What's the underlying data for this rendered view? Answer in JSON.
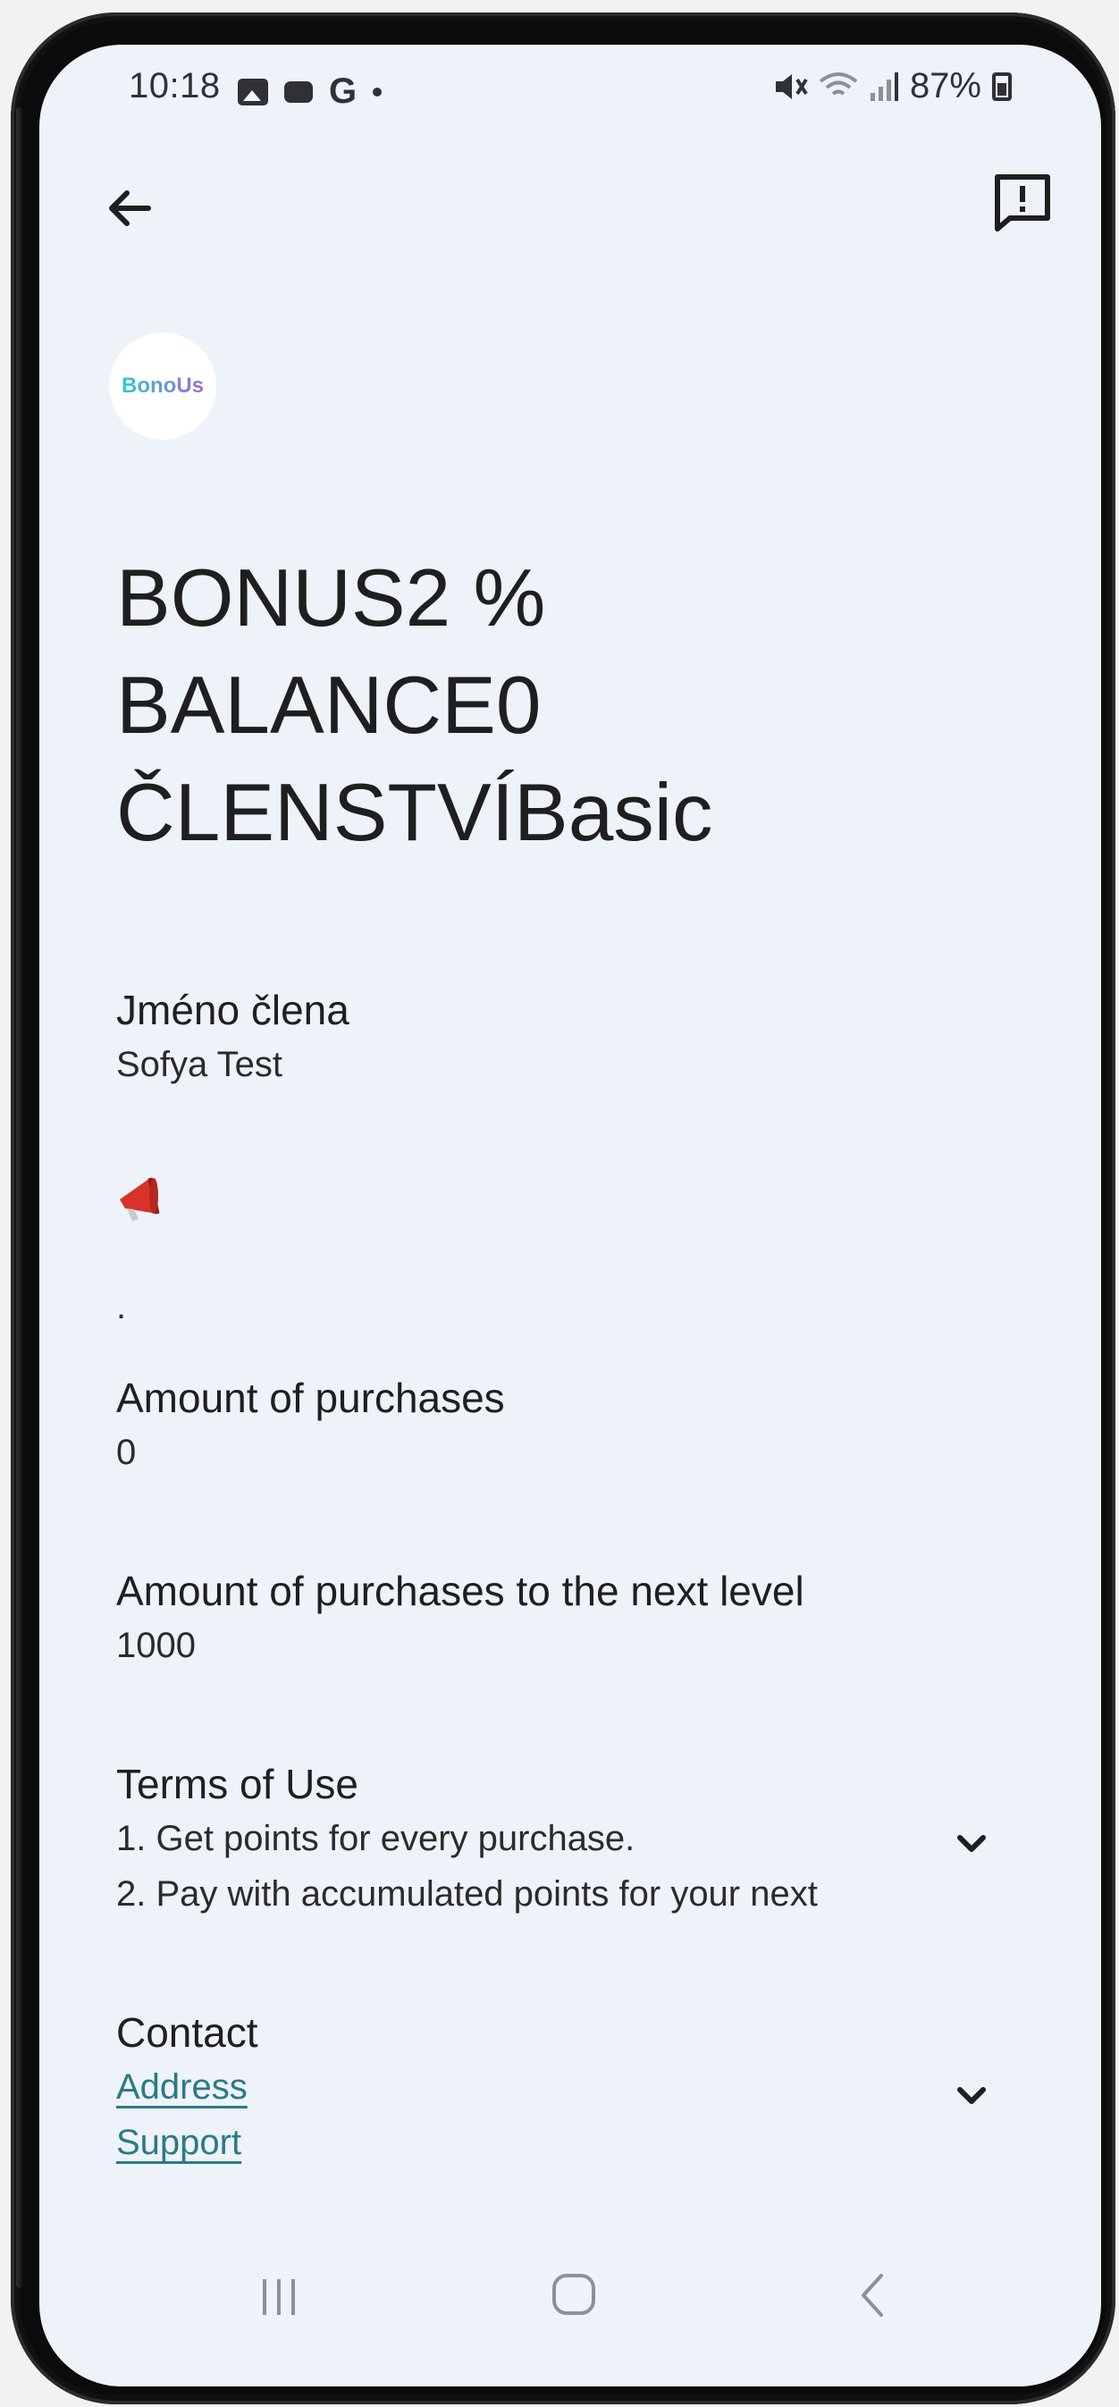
{
  "status_bar": {
    "time": "10:18",
    "google_letter": "G",
    "battery": "87%"
  },
  "logo": {
    "text": "BonoUs"
  },
  "headline": {
    "line1": "BONUS2 %",
    "line2": "BALANCE0",
    "line3": "ČLENSTVÍBasic"
  },
  "member": {
    "label": "Jméno člena",
    "value": "Sofya Test"
  },
  "announcement": {
    "icon": "megaphone-icon",
    "value": "."
  },
  "purchases": {
    "label": "Amount of purchases",
    "value": "0"
  },
  "next_level": {
    "label": "Amount of purchases to the next level",
    "value": "1000"
  },
  "terms": {
    "label": "Terms of Use",
    "line1": "1. Get points for every purchase.",
    "line2": "2. Pay with accumulated points for your next"
  },
  "contact": {
    "label": "Contact",
    "address_link": "Address",
    "support_link": "Support"
  },
  "colors": {
    "background": "#eef2f9",
    "text": "#1f1f1f",
    "link": "#2a7a86",
    "megaphone": "#d8322c"
  }
}
